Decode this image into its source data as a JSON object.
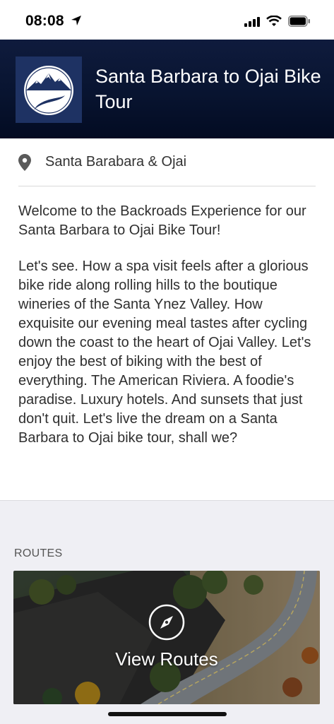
{
  "status_bar": {
    "time": "08:08"
  },
  "header": {
    "title": "Santa Barbara to Ojai Bike Tour",
    "logo_icon": "mountain-road-logo"
  },
  "location": {
    "text": "Santa Barabara & Ojai",
    "icon": "map-pin-icon"
  },
  "intro": "Welcome to the Backroads Experience for our Santa Barbara to Ojai Bike Tour!",
  "description": "Let's see. How a spa visit feels after a glorious bike ride along rolling hills to the boutique wineries of the Santa Ynez Valley. How exquisite our evening meal tastes after cycling down the coast to the heart of Ojai Valley. Let's enjoy the best of biking with the best of everything. The American Riviera. A foodie's paradise. Luxury hotels. And sunsets that just don't quit. Let's live the dream on a Santa Barbara to Ojai bike tour, shall we?",
  "routes": {
    "section_label": "ROUTES",
    "card_label": "View Routes",
    "card_icon": "compass-icon"
  },
  "colors": {
    "header_bg": "#081430",
    "logo_bg": "#1e3263",
    "section_bg": "#efeff4"
  }
}
